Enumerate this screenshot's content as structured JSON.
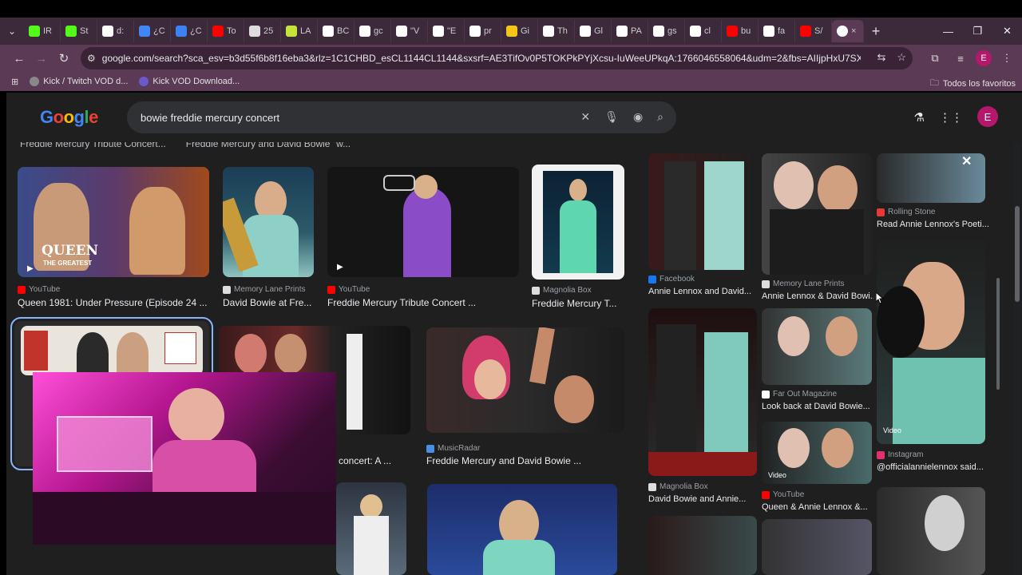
{
  "browser": {
    "tabs": [
      {
        "label": "IR",
        "color": "#53fc18"
      },
      {
        "label": "St",
        "color": "#53fc18"
      },
      {
        "label": "d:",
        "color": "#ffffff"
      },
      {
        "label": "¿C",
        "color": "#4285f4"
      },
      {
        "label": "¿C",
        "color": "#3b82f6"
      },
      {
        "label": "To",
        "color": "#ff0000"
      },
      {
        "label": "25",
        "color": "#dddddd"
      },
      {
        "label": "LA",
        "color": "#c6e33a"
      },
      {
        "label": "BC",
        "color": "#ffffff"
      },
      {
        "label": "gc",
        "color": "#ffffff"
      },
      {
        "label": "\"V",
        "color": "#ffffff"
      },
      {
        "label": "\"E",
        "color": "#ffffff"
      },
      {
        "label": "pr",
        "color": "#ffffff"
      },
      {
        "label": "Gi",
        "color": "#f5c518"
      },
      {
        "label": "Th",
        "color": "#ffffff"
      },
      {
        "label": "Gl",
        "color": "#ffffff"
      },
      {
        "label": "PA",
        "color": "#ffffff"
      },
      {
        "label": "gs",
        "color": "#ffffff"
      },
      {
        "label": "cl",
        "color": "#ffffff"
      },
      {
        "label": "bu",
        "color": "#ff0000"
      },
      {
        "label": "fa",
        "color": "#ffffff"
      },
      {
        "label": "S/",
        "color": "#ff0000"
      }
    ],
    "active_tab_close": "×",
    "new_tab": "+",
    "url": "google.com/search?sca_esv=b3d55f6b8f16eba3&rlz=1C1CHBD_esCL1144CL1144&sxsrf=AE3TifOv0P5TOKPkPYjXcsu-IuWeeUPkqA:1766046558064&udm=2&fbs=AIIjpHxU7SXXniUZfeShr2fp4...",
    "profile_initial": "E",
    "bookmarks": [
      "Kick / Twitch VOD d...",
      "Kick VOD Download..."
    ],
    "bookmarks_all": "Todos los favoritos"
  },
  "google": {
    "logo": "Google",
    "query": "bowie freddie mercury concert",
    "account_initial": "E"
  },
  "results_top_strip": [
    "Freddie Mercury Tribute Concert...",
    "Freddie Mercury and David Bowie \"w..."
  ],
  "results": [
    {
      "source": "YouTube",
      "title": "Queen 1981: Under Pressure (Episode 24 ...",
      "src_color": "#ff0000",
      "overlay": "QUEEN",
      "overlay2": "THE GREATEST"
    },
    {
      "source": "Memory Lane Prints",
      "title": "David Bowie at Fre...",
      "src_color": "#dddddd"
    },
    {
      "source": "YouTube",
      "title": "Freddie Mercury Tribute Concert ...",
      "src_color": "#ff0000"
    },
    {
      "source": "Magnolia Box",
      "title": "Freddie Mercury T...",
      "src_color": "#dddddd"
    },
    {
      "source": "",
      "title": "concert: A ...",
      "src_color": "#dddddd"
    },
    {
      "source": "MusicRadar",
      "title": "Freddie Mercury and David Bowie ...",
      "src_color": "#4a90e2"
    }
  ],
  "side_panel": [
    {
      "source": "Rolling Stone",
      "title": "Read Annie Lennox's Poeti...",
      "src_color": "#e53935"
    },
    {
      "source": "Facebook",
      "title": "Annie Lennox and David...",
      "src_color": "#1877f2"
    },
    {
      "source": "Memory Lane Prints",
      "title": "Annie Lennox & David Bowi...",
      "src_color": "#dddddd"
    },
    {
      "source": "Far Out Magazine",
      "title": "Look back at David Bowie...",
      "src_color": "#ffffff"
    },
    {
      "source": "Instagram",
      "title": "@officialannielennox said...",
      "src_color": "#e1306c",
      "badge": "Video"
    },
    {
      "source": "Magnolia Box",
      "title": "David Bowie and Annie...",
      "src_color": "#dddddd"
    },
    {
      "source": "YouTube",
      "title": "Queen & Annie Lennox &...",
      "src_color": "#ff0000",
      "badge": "Video"
    }
  ]
}
